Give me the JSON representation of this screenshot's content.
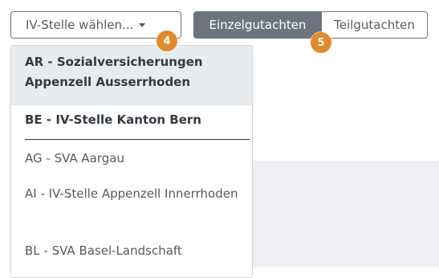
{
  "colors": {
    "accent": "#6c757d",
    "badge": "#e08a2c",
    "highlight": "#e9ecef"
  },
  "dropdown": {
    "toggle_label": "IV-Stelle wählen...",
    "caret_icon": "caret-down-icon",
    "items": [
      {
        "label": "AR - Sozialversicherungen Appenzell Ausserrhoden",
        "bold": true,
        "highlighted": true
      },
      {
        "label": "BE - IV-Stelle Kanton Bern",
        "bold": true
      },
      {
        "label": "AG - SVA Aargau",
        "bold": false
      },
      {
        "label": "AI - IV-Stelle Appenzell Innerrhoden",
        "bold": false
      },
      {
        "label": "BL - SVA Basel-Landschaft",
        "bold": false
      }
    ]
  },
  "toggle_group": {
    "active_label": "Einzelgutachten",
    "inactive_label": "Teilgutachten"
  },
  "badges": {
    "four": "4",
    "five": "5"
  }
}
